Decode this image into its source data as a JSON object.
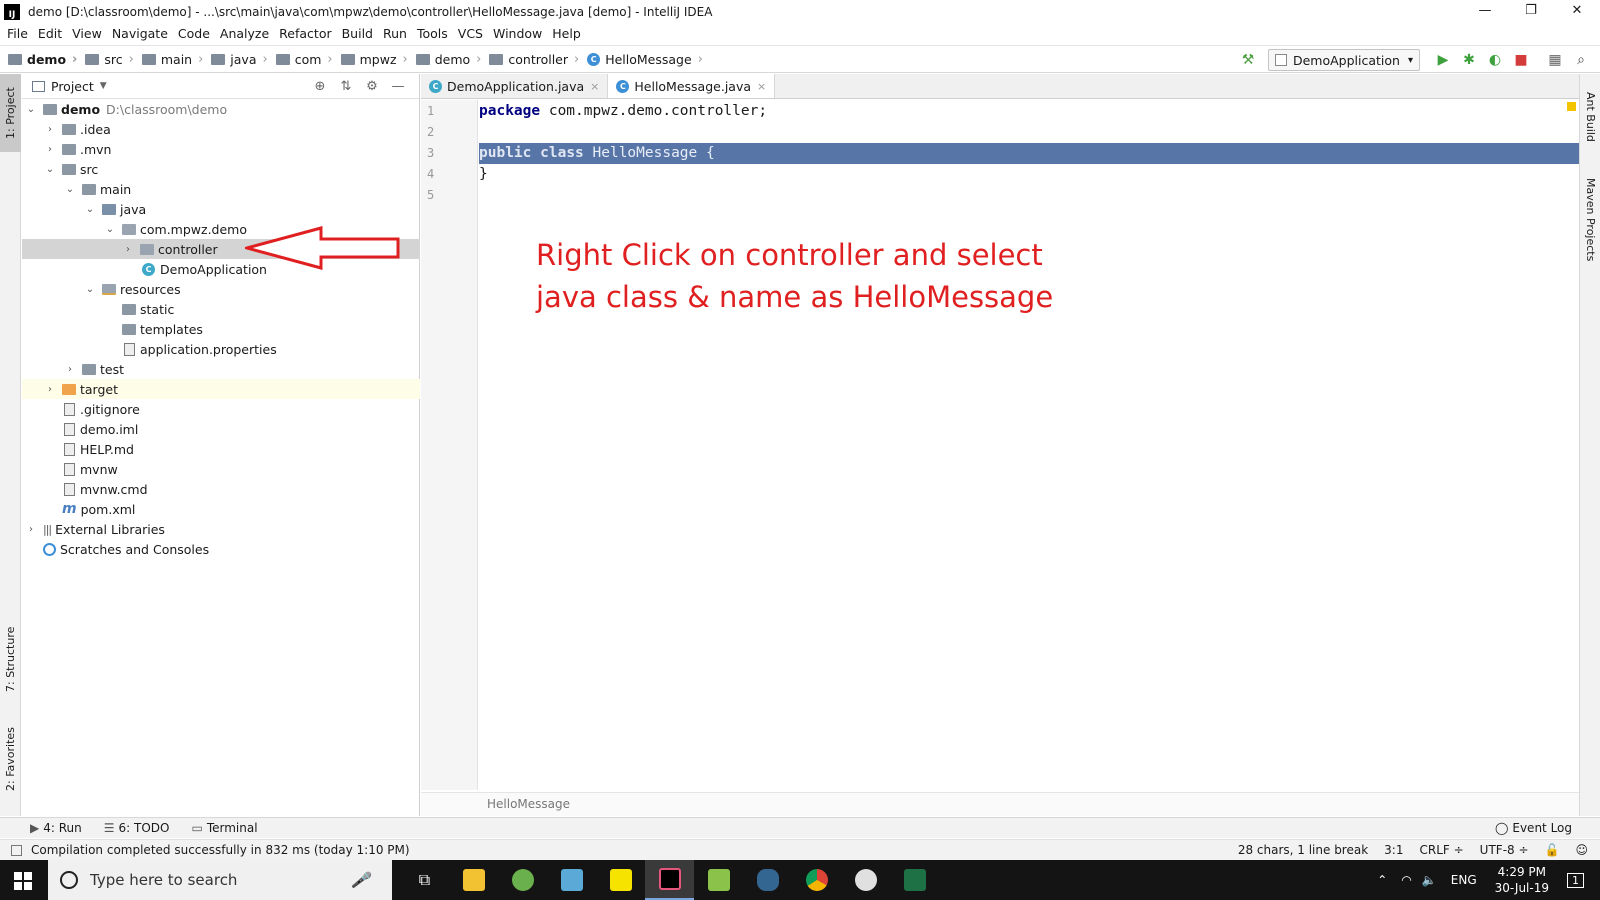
{
  "window": {
    "title": "demo [D:\\classroom\\demo] - ...\\src\\main\\java\\com\\mpwz\\demo\\controller\\HelloMessage.java [demo] - IntelliJ IDEA",
    "app_icon": "IJ",
    "controls": [
      "—",
      "❐",
      "✕"
    ]
  },
  "menu": [
    "File",
    "Edit",
    "View",
    "Navigate",
    "Code",
    "Analyze",
    "Refactor",
    "Build",
    "Run",
    "Tools",
    "VCS",
    "Window",
    "Help"
  ],
  "breadcrumbs": [
    "demo",
    "src",
    "main",
    "java",
    "com",
    "mpwz",
    "demo",
    "controller",
    "HelloMessage"
  ],
  "run_config": "DemoApplication",
  "left_tabs": {
    "project": "1: Project",
    "structure": "7: Structure",
    "favorites": "2: Favorites"
  },
  "right_tabs": {
    "ant": "Ant Build",
    "maven": "Maven Projects"
  },
  "project_panel": {
    "title": "Project",
    "tree": [
      {
        "label": "demo",
        "extra": "D:\\classroom\\demo"
      },
      {
        "label": ".idea"
      },
      {
        "label": ".mvn"
      },
      {
        "label": "src"
      },
      {
        "label": "main"
      },
      {
        "label": "java"
      },
      {
        "label": "com.mpwz.demo"
      },
      {
        "label": "controller"
      },
      {
        "label": "DemoApplication"
      },
      {
        "label": "resources"
      },
      {
        "label": "static"
      },
      {
        "label": "templates"
      },
      {
        "label": "application.properties"
      },
      {
        "label": "test"
      },
      {
        "label": "target"
      },
      {
        "label": ".gitignore"
      },
      {
        "label": "demo.iml"
      },
      {
        "label": "HELP.md"
      },
      {
        "label": "mvnw"
      },
      {
        "label": "mvnw.cmd"
      },
      {
        "label": "pom.xml"
      },
      {
        "label": "External Libraries"
      },
      {
        "label": "Scratches and Consoles"
      }
    ]
  },
  "editor": {
    "tabs": [
      {
        "label": "DemoApplication.java",
        "close": "×"
      },
      {
        "label": "HelloMessage.java",
        "close": "×"
      }
    ],
    "line_numbers": [
      "1",
      "2",
      "3",
      "4",
      "5"
    ],
    "code": {
      "l1_kw": "package",
      "l1_rest": " com.mpwz.demo.controller;",
      "l3_kw1": "public",
      "l3_kw2": "class",
      "l3_rest": " HelloMessage {",
      "l4": "}"
    },
    "annotation": [
      "Right Click on controller and select",
      "java class & name as HelloMessage"
    ],
    "breadcrumb_footer": "HelloMessage"
  },
  "bottom_tools": {
    "run": "4: Run",
    "todo": "6: TODO",
    "terminal": "Terminal",
    "event_log": "Event Log"
  },
  "status": {
    "message": "Compilation completed successfully in 832 ms (today 1:10 PM)",
    "chars": "28 chars, 1 line break",
    "position": "3:1",
    "line_sep": "CRLF ÷",
    "encoding": "UTF-8 ÷"
  },
  "taskbar": {
    "search_placeholder": "Type here to search",
    "lang": "ENG",
    "time": "4:29 PM",
    "date": "30-Jul-19",
    "notif_count": "1"
  },
  "colors": {
    "highlight": "#5875a8",
    "keyword": "#000080",
    "annotation": "#e02020",
    "arrow": "#e02020"
  }
}
